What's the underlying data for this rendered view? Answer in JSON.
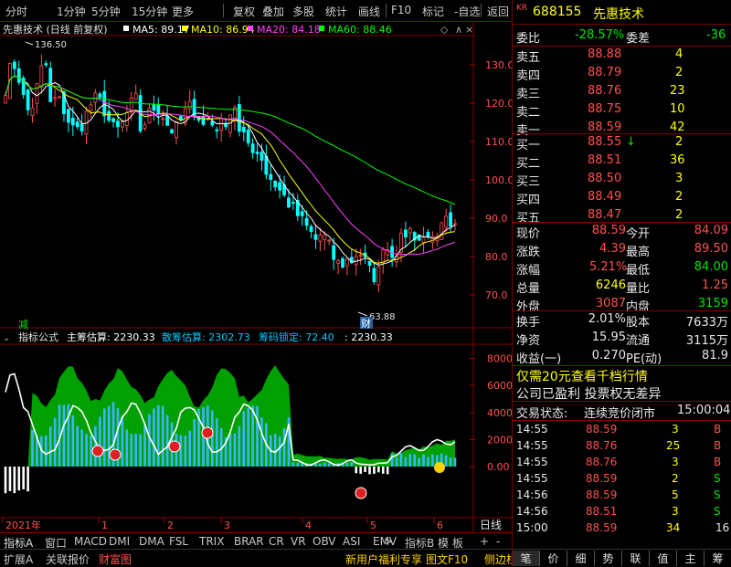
{
  "toolbar": {
    "items": [
      "分时",
      "1分钟",
      "5分钟",
      "15分钟",
      "更多",
      "复权",
      "叠加",
      "多股",
      "统计",
      "画线",
      "F10",
      "标记",
      "-自选",
      "返回"
    ]
  },
  "main_chart": {
    "title": "先惠技术 (日线 前复权)",
    "ma": [
      {
        "label": "MA5: 89.17",
        "color": "#ffffff"
      },
      {
        "label": "MA10: 86.94",
        "color": "#ffff00"
      },
      {
        "label": "MA20: 84.18",
        "color": "#ff40ff"
      },
      {
        "label": "MA60: 88.46",
        "color": "#00ff00"
      }
    ],
    "high_label": "136.50",
    "low_label": "63.88",
    "y_ticks": [
      "130.0",
      "120.0",
      "110.0",
      "100.0",
      "90.0",
      "80.0",
      "70.0"
    ],
    "markers": {
      "reduce": "减",
      "finance": "财"
    }
  },
  "indicator": {
    "name": "指标公式",
    "labels": [
      {
        "text": "主筹估算: 2230.33",
        "color": "#ffffff"
      },
      {
        "text": "散筹估算: 2302.73",
        "color": "#00c8ff"
      },
      {
        "text": "筹码锁定: 72.40",
        "color": "#00c8ff"
      },
      {
        "text": ": 2230.33",
        "color": "#ffffff"
      }
    ],
    "y_ticks": [
      "8000",
      "6000",
      "4000",
      "2000",
      "0.00"
    ]
  },
  "x_axis": {
    "labels": [
      "2021年",
      "1",
      "2",
      "3",
      "4",
      "5",
      "6"
    ],
    "period": "日线"
  },
  "tabs": [
    "指标A",
    "窗口",
    "MACD",
    "DMI",
    "DMA",
    "FSL",
    "TRIX",
    "BRAR",
    "CR",
    "VR",
    "OBV",
    "ASI",
    "EMV"
  ],
  "tabs_right": [
    "指标B",
    "模",
    "板"
  ],
  "bottom_left": [
    "扩展A",
    "关联报价",
    "财富图"
  ],
  "bottom_center": [
    "新用户福利专享",
    "图文F10",
    "侧边栏"
  ],
  "bottom_right": [
    "笔",
    "价",
    "细",
    "势",
    "联",
    "值",
    "主",
    "筹"
  ],
  "quote": {
    "market": "KR",
    "code": "688155",
    "name": "先惠技术",
    "wb_label": "委比",
    "wb": "-28.57%",
    "wc_label": "委差",
    "wc": "-36",
    "asks": [
      {
        "label": "卖五",
        "price": "88.88",
        "vol": "4"
      },
      {
        "label": "卖四",
        "price": "88.79",
        "vol": "2"
      },
      {
        "label": "卖三",
        "price": "88.76",
        "vol": "23"
      },
      {
        "label": "卖二",
        "price": "88.75",
        "vol": "10"
      },
      {
        "label": "卖一",
        "price": "88.59",
        "vol": "42"
      }
    ],
    "bids": [
      {
        "label": "买一",
        "price": "88.55",
        "vol": "2",
        "arrow": "↓"
      },
      {
        "label": "买二",
        "price": "88.51",
        "vol": "36"
      },
      {
        "label": "买三",
        "price": "88.50",
        "vol": "3"
      },
      {
        "label": "买四",
        "price": "88.49",
        "vol": "2"
      },
      {
        "label": "买五",
        "price": "88.47",
        "vol": "2"
      }
    ],
    "stats": [
      {
        "l1": "现价",
        "v1": "88.59",
        "c1": "red",
        "l2": "今开",
        "v2": "84.09",
        "c2": "red"
      },
      {
        "l1": "涨跌",
        "v1": "4.39",
        "c1": "red",
        "l2": "最高",
        "v2": "89.50",
        "c2": "red"
      },
      {
        "l1": "涨幅",
        "v1": "5.21%",
        "c1": "red",
        "l2": "最低",
        "v2": "84.00",
        "c2": "grn"
      },
      {
        "l1": "总量",
        "v1": "6246",
        "c1": "yel",
        "l2": "量比",
        "v2": "1.25",
        "c2": "red"
      },
      {
        "l1": "外盘",
        "v1": "3087",
        "c1": "red",
        "l2": "内盘",
        "v2": "3159",
        "c2": "grn"
      }
    ],
    "stats2": [
      {
        "l1": "换手",
        "v1": "2.01%",
        "l2": "股本",
        "v2": "7633万"
      },
      {
        "l1": "净资",
        "v1": "15.95",
        "l2": "流通",
        "v2": "3115万"
      },
      {
        "l1": "收益(一)",
        "v1": "0.270",
        "l2": "PE(动)",
        "v2": "81.9"
      }
    ],
    "promo": "仅需20元查看千档行情",
    "notice": "公司已盈利 投票权无差异",
    "status_label": "交易状态:",
    "status": "连续竞价闭市",
    "status_time": "15:00:04",
    "ticks": [
      {
        "time": "14:55",
        "price": "88.59",
        "vol": "3",
        "side": "B"
      },
      {
        "time": "14:55",
        "price": "88.76",
        "vol": "25",
        "side": "B"
      },
      {
        "time": "14:55",
        "price": "88.76",
        "vol": "3",
        "side": "B"
      },
      {
        "time": "14:55",
        "price": "88.59",
        "vol": "2",
        "side": "S"
      },
      {
        "time": "14:56",
        "price": "88.59",
        "vol": "5",
        "side": "S"
      },
      {
        "time": "14:56",
        "price": "88.51",
        "vol": "3",
        "side": "S"
      },
      {
        "time": "15:00",
        "price": "88.59",
        "vol": "34",
        "side": "16"
      }
    ]
  },
  "colors": {
    "up": "#ff5050",
    "down": "#00e600",
    "ma60": "#00ff00",
    "ma20": "#ff40ff",
    "ma10": "#ffff00",
    "ma5": "#ffffff",
    "green_area": "#00a000",
    "blue_bars": "#3db4ff"
  }
}
